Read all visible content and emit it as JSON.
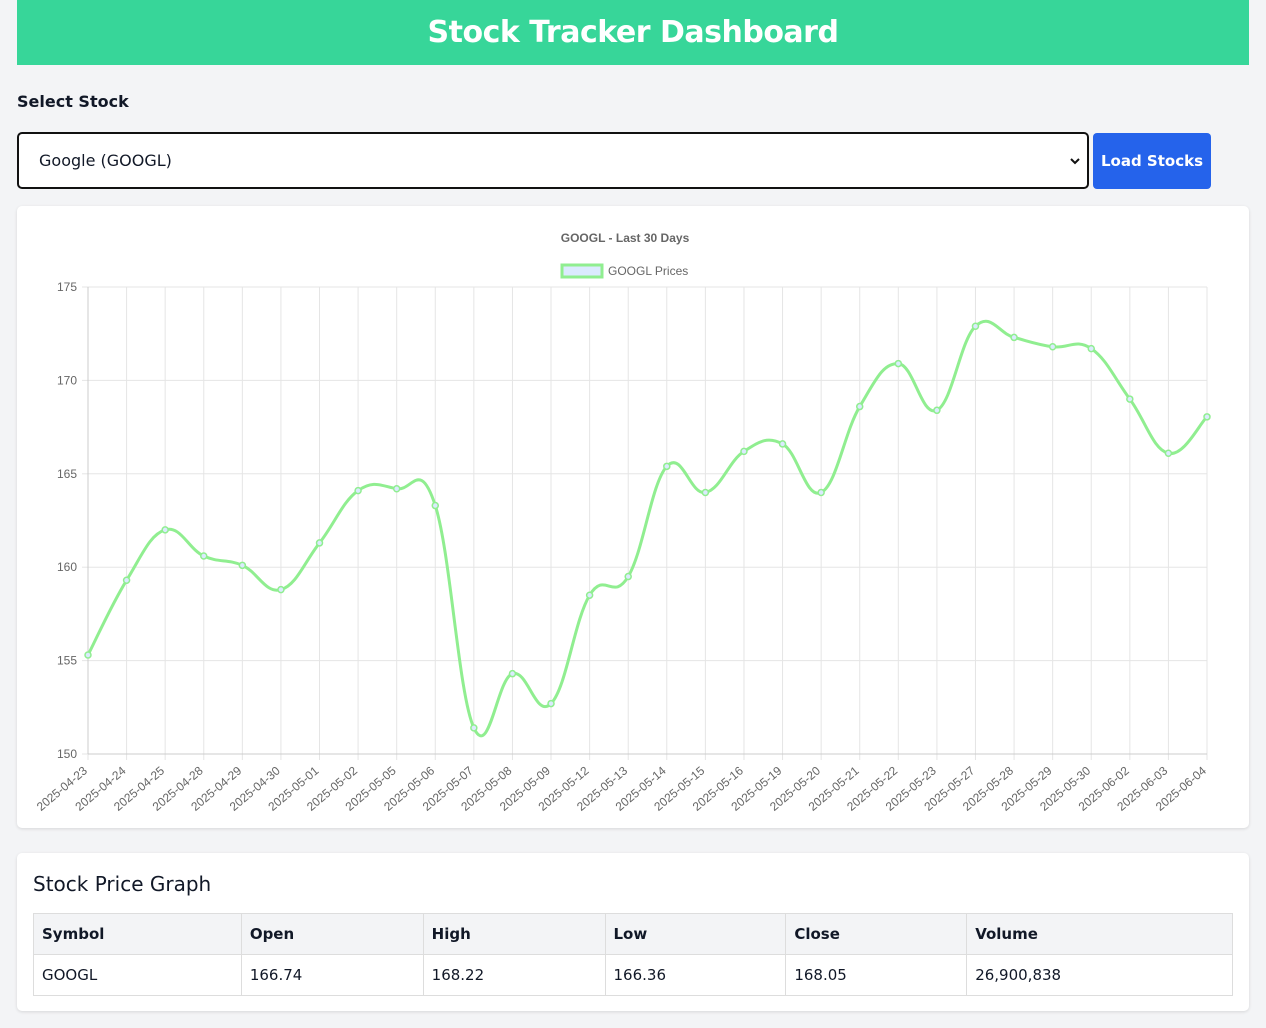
{
  "header": {
    "title": "Stock Tracker Dashboard"
  },
  "selector": {
    "label": "Select Stock",
    "selected": "Google (GOOGL)",
    "load_button": "Load Stocks"
  },
  "chart_data": {
    "type": "line",
    "title": "GOOGL - Last 30 Days",
    "legend": "top",
    "grid": true,
    "ylim": [
      150,
      175
    ],
    "yticks": [
      150,
      155,
      160,
      165,
      170,
      175
    ],
    "categories": [
      "2025-04-23",
      "2025-04-24",
      "2025-04-25",
      "2025-04-28",
      "2025-04-29",
      "2025-04-30",
      "2025-05-01",
      "2025-05-02",
      "2025-05-05",
      "2025-05-06",
      "2025-05-07",
      "2025-05-08",
      "2025-05-09",
      "2025-05-12",
      "2025-05-13",
      "2025-05-14",
      "2025-05-15",
      "2025-05-16",
      "2025-05-19",
      "2025-05-20",
      "2025-05-21",
      "2025-05-22",
      "2025-05-23",
      "2025-05-27",
      "2025-05-28",
      "2025-05-29",
      "2025-05-30",
      "2025-06-02",
      "2025-06-03",
      "2025-06-04"
    ],
    "series": [
      {
        "name": "GOOGL Prices",
        "color": "#90ee90",
        "fill": "#dbeafe",
        "values": [
          155.3,
          159.3,
          162.0,
          160.6,
          160.1,
          158.8,
          161.3,
          164.1,
          164.2,
          163.3,
          151.4,
          154.3,
          152.7,
          158.5,
          159.5,
          165.4,
          164.0,
          166.2,
          166.6,
          164.0,
          168.6,
          170.9,
          168.4,
          172.9,
          172.3,
          171.8,
          171.7,
          169.0,
          166.1,
          168.05
        ]
      }
    ]
  },
  "table": {
    "title": "Stock Price Graph",
    "headers": [
      "Symbol",
      "Open",
      "High",
      "Low",
      "Close",
      "Volume"
    ],
    "rows": [
      [
        "GOOGL",
        "166.74",
        "168.22",
        "166.36",
        "168.05",
        "26,900,838"
      ]
    ]
  }
}
